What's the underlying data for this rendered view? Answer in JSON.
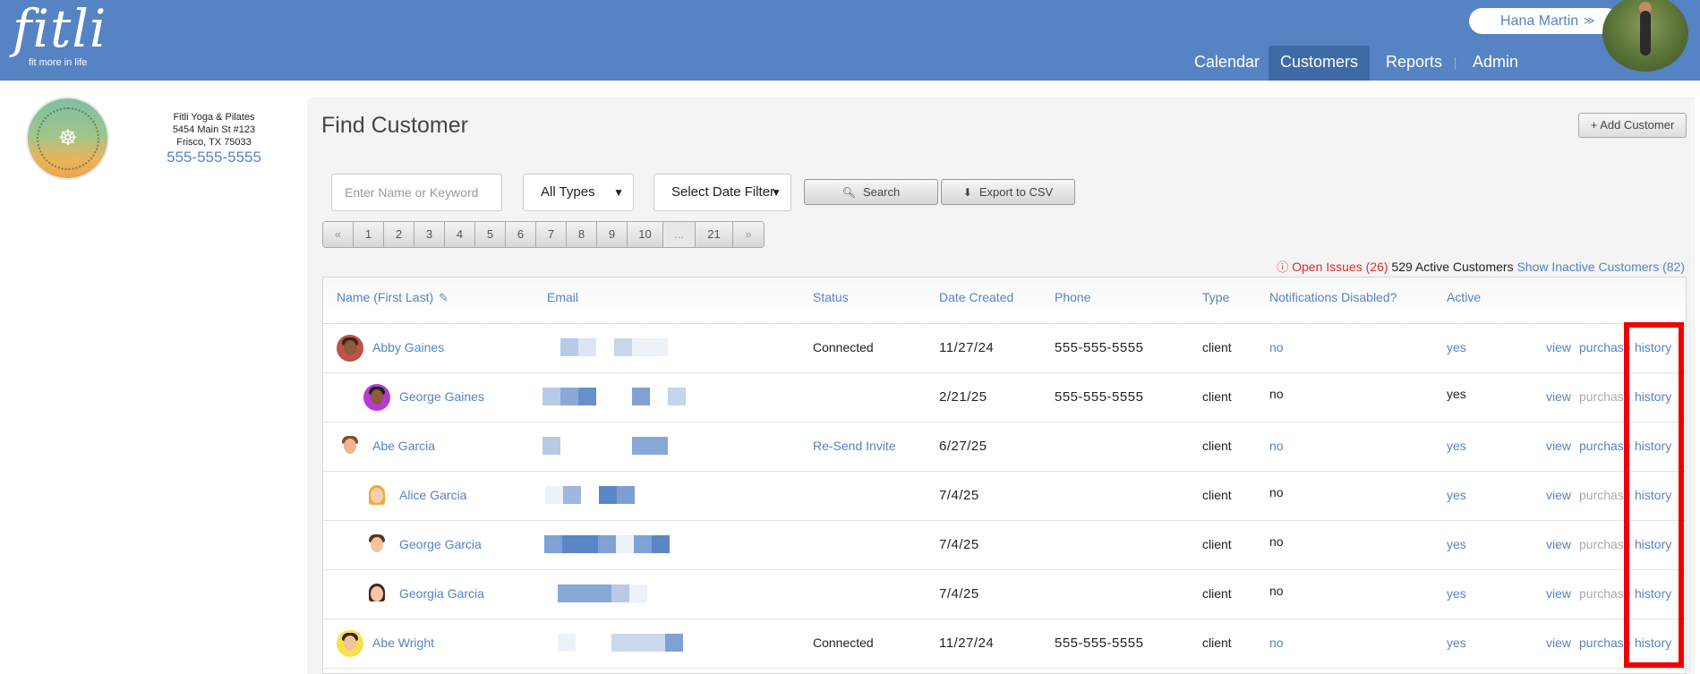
{
  "brand": {
    "logo_text": "fitli",
    "tagline": "fit more in life"
  },
  "user": {
    "name": "Hana Martin",
    "chevron": "≫"
  },
  "nav": {
    "items": [
      {
        "label": "Calendar"
      },
      {
        "label": "Customers"
      },
      {
        "label": "Reports"
      },
      {
        "label": "Admin"
      }
    ],
    "active": "Customers"
  },
  "studio": {
    "name": "Fitli Yoga & Pilates",
    "address1": "5454 Main St #123",
    "address2": "Frisco, TX 75033",
    "phone": "555-555-5555"
  },
  "page": {
    "title": "Find Customer",
    "add_button": "+ Add Customer"
  },
  "filters": {
    "search_placeholder": "Enter Name or Keyword",
    "type_select": "All Types",
    "date_select": "Select Date Filter",
    "search_button": "Search",
    "export_button": "Export to CSV"
  },
  "pager": {
    "prev": "«",
    "pages": [
      "1",
      "2",
      "3",
      "4",
      "5",
      "6",
      "7",
      "8",
      "9",
      "10"
    ],
    "ellipsis": "...",
    "last": "21",
    "next": "»"
  },
  "summary": {
    "open_issues": "Open Issues (26)",
    "active": "529 Active Customers",
    "inactive_link": "Show Inactive Customers (82)"
  },
  "table": {
    "headers": {
      "name": "Name (First Last)",
      "email": "Email",
      "status": "Status",
      "date": "Date Created",
      "phone": "Phone",
      "type": "Type",
      "notifications": "Notifications Disabled?",
      "active": "Active"
    },
    "actions": {
      "view": "view",
      "purchase": "purchase",
      "history": "history"
    },
    "rows": [
      {
        "name": "Abby Gaines",
        "status": "Connected",
        "date": "11/27/24",
        "phone": "555-555-5555",
        "type": "client",
        "notif": "no",
        "active": "yes"
      },
      {
        "name": "George Gaines",
        "status": "",
        "date": "2/21/25",
        "phone": "555-555-5555",
        "type": "client",
        "notif": "no",
        "active": "yes"
      },
      {
        "name": "Abe Garcia",
        "status": "Re-Send Invite",
        "date": "6/27/25",
        "phone": "",
        "type": "client",
        "notif": "no",
        "active": "yes"
      },
      {
        "name": "Alice Garcia",
        "status": "",
        "date": "7/4/25",
        "phone": "",
        "type": "client",
        "notif": "no",
        "active": "yes"
      },
      {
        "name": "George Garcia",
        "status": "",
        "date": "7/4/25",
        "phone": "",
        "type": "client",
        "notif": "no",
        "active": "yes"
      },
      {
        "name": "Georgia Garcia",
        "status": "",
        "date": "7/4/25",
        "phone": "",
        "type": "client",
        "notif": "no",
        "active": "yes"
      },
      {
        "name": "Abe Wright",
        "status": "Connected",
        "date": "11/27/24",
        "phone": "555-555-5555",
        "type": "client",
        "notif": "no",
        "active": "yes"
      }
    ]
  },
  "colors": {
    "brand_blue": "#5683c3",
    "nav_active": "#3e6aa8",
    "issue_red": "#d43030",
    "highlight_red": "#ee0000"
  }
}
